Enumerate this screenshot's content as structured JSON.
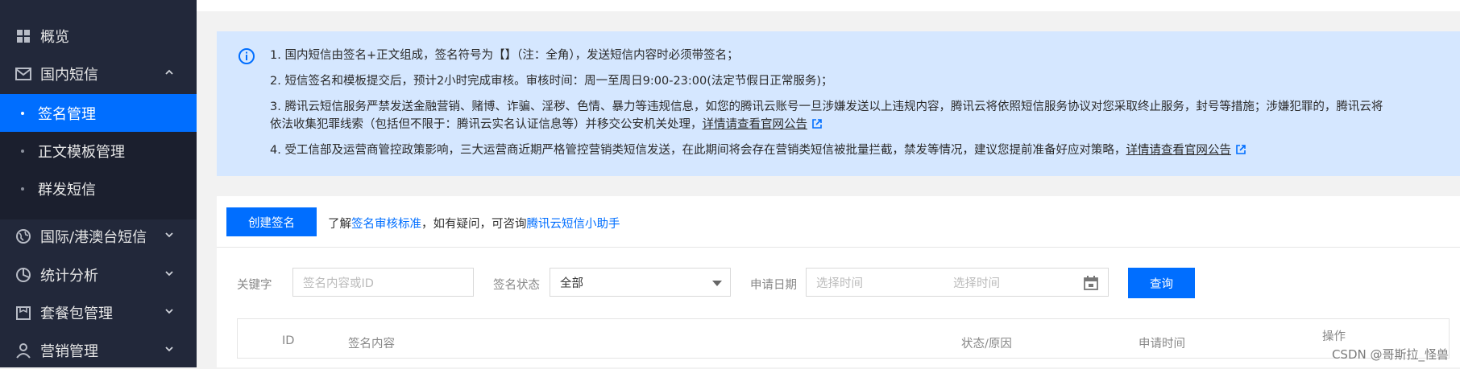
{
  "sidebar": {
    "items": [
      {
        "label": "概览",
        "icon": "grid-icon"
      },
      {
        "label": "国内短信",
        "icon": "mail-icon",
        "expanded": true
      },
      {
        "label": "国际/港澳台短信",
        "icon": "globe-icon"
      },
      {
        "label": "统计分析",
        "icon": "pie-chart-icon"
      },
      {
        "label": "套餐包管理",
        "icon": "package-icon"
      },
      {
        "label": "营销管理",
        "icon": "user-icon"
      }
    ],
    "sub_items": [
      {
        "label": "签名管理",
        "active": true
      },
      {
        "label": "正文模板管理"
      },
      {
        "label": "群发短信"
      }
    ]
  },
  "notice": {
    "lines": [
      "1. 国内短信由签名+正文组成，签名符号为【】（注：全角），发送短信内容时必须带签名；",
      "2. 短信签名和模板提交后，预计2小时完成审核。审核时间：周一至周日9:00-23:00(法定节假日正常服务)；",
      "3. 腾讯云短信服务严禁发送金融营销、赌博、诈骗、淫秽、色情、暴力等违规信息，如您的腾讯云账号一旦涉嫌发送以上违规内容，腾讯云将依照短信服务协议对您采取终止服务，封号等措施；涉嫌犯罪的，腾讯云将",
      "依法收集犯罪线索（包括但不限于：腾讯云实名认证信息等）并移交公安机关处理，",
      "4. 受工信部及运营商管控政策影响，三大运营商近期严格管控营销类短信发送，在此期间将会存在营销类短信被批量拦截，禁发等情况，建议您提前准备好应对策略，"
    ],
    "link_label": "详情请查看官网公告"
  },
  "toolbar": {
    "create_label": "创建签名",
    "help_prefix": "了解",
    "help_link1": "签名审核标准",
    "help_middle": "，如有疑问，可咨询",
    "help_link2": "腾讯云短信小助手"
  },
  "filters": {
    "keyword_label": "关键字",
    "keyword_placeholder": "签名内容或ID",
    "status_label": "签名状态",
    "status_value": "全部",
    "date_label": "申请日期",
    "date_start_placeholder": "选择时间",
    "date_end_placeholder": "选择时间",
    "query_label": "查询"
  },
  "table": {
    "columns": [
      "ID",
      "签名内容",
      "状态/原因",
      "申请时间",
      "操作"
    ]
  },
  "watermark": "CSDN @哥斯拉_怪兽",
  "colors": {
    "accent": "#006eff",
    "sidebar": "#22283a",
    "notice_bg": "#d5e7ff"
  }
}
